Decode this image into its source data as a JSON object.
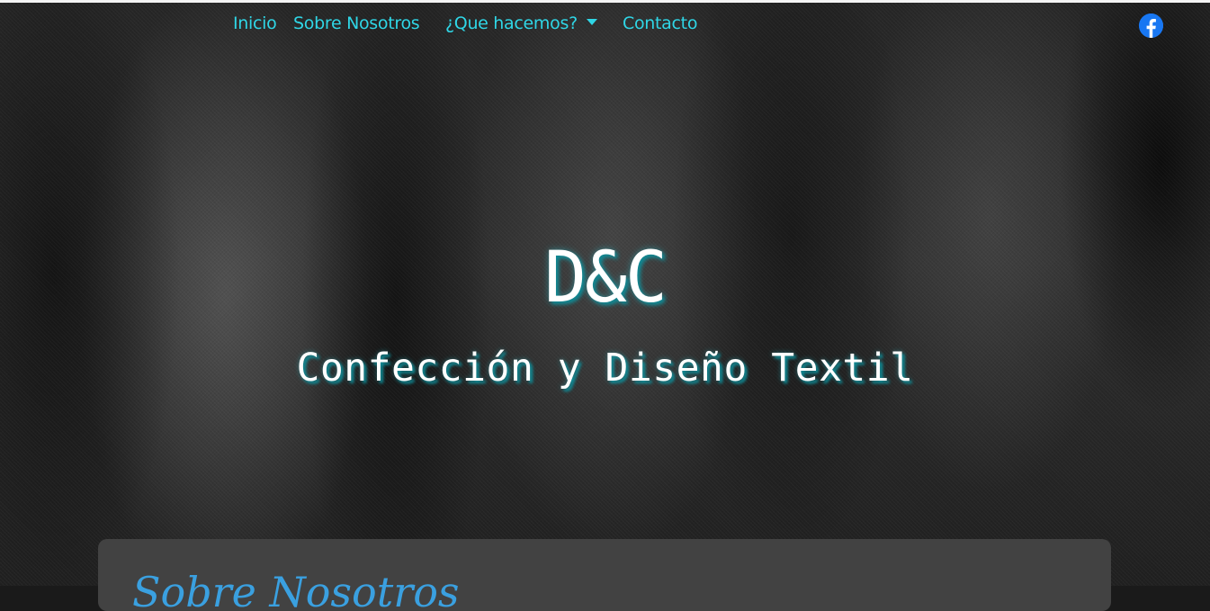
{
  "nav": {
    "items": [
      {
        "label": "Inicio"
      },
      {
        "label": "Sobre Nosotros"
      },
      {
        "label": "¿Que hacemos?"
      },
      {
        "label": "Contacto"
      }
    ],
    "social_icon": "facebook-icon"
  },
  "hero": {
    "title": "D&C",
    "subtitle": "Confección y Diseño Textil"
  },
  "card": {
    "heading": "Sobre Nosotros"
  },
  "colors": {
    "accent": "#2fd6e6",
    "facebook": "#1877f2",
    "card_bg": "#424242",
    "card_heading": "#3aa0e0"
  }
}
